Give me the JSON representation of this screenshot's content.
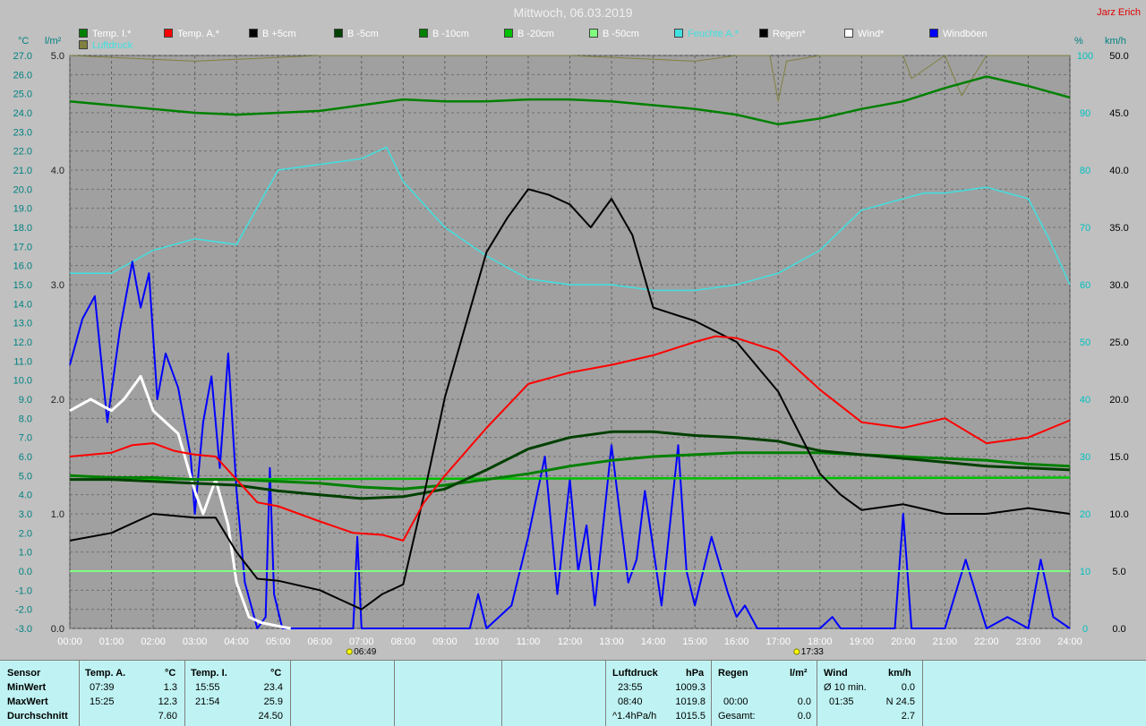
{
  "title": "Mittwoch, 06.03.2019",
  "author": "Jarz Erich",
  "units": {
    "left_temp": "°C",
    "left_rain": "l/m²",
    "right_pct": "%",
    "right_wind": "km/h"
  },
  "legend": [
    {
      "label": "Temp. I.*",
      "color": "#008000"
    },
    {
      "label": "Temp. A.*",
      "color": "#ff0000"
    },
    {
      "label": "B +5cm",
      "color": "#000000"
    },
    {
      "label": "B -5cm",
      "color": "#004000"
    },
    {
      "label": "B -10cm",
      "color": "#008000"
    },
    {
      "label": "B -20cm",
      "color": "#00c000"
    },
    {
      "label": "B -50cm",
      "color": "#80ff80"
    },
    {
      "label": "Feuchte A.*",
      "color": "#40e0e0"
    },
    {
      "label": "Regen*",
      "color": "#000000"
    },
    {
      "label": "Wind*",
      "color": "#ffffff"
    },
    {
      "label": "Windböen",
      "color": "#0000ff"
    },
    {
      "label": "Luftdruck",
      "color": "#808040"
    }
  ],
  "sunrise": "06:49",
  "sunset": "17:33",
  "chart_data": {
    "type": "line",
    "x_unit": "hours",
    "xlim": [
      0,
      24
    ],
    "x_ticks": [
      "00:00",
      "01:00",
      "02:00",
      "03:00",
      "04:00",
      "05:00",
      "06:00",
      "07:00",
      "08:00",
      "09:00",
      "10:00",
      "11:00",
      "12:00",
      "13:00",
      "14:00",
      "15:00",
      "16:00",
      "17:00",
      "18:00",
      "19:00",
      "20:00",
      "21:00",
      "22:00",
      "23:00",
      "24:00"
    ],
    "y_temp": {
      "lim": [
        -3,
        27
      ],
      "ticks": [
        "-3.0",
        "-2.0",
        "-1.0",
        "0.0",
        "1.0",
        "2.0",
        "3.0",
        "4.0",
        "5.0",
        "6.0",
        "7.0",
        "8.0",
        "9.0",
        "10.0",
        "11.0",
        "12.0",
        "13.0",
        "14.0",
        "15.0",
        "16.0",
        "17.0",
        "18.0",
        "19.0",
        "20.0",
        "21.0",
        "22.0",
        "23.0",
        "24.0",
        "25.0",
        "26.0",
        "27.0"
      ]
    },
    "y_rain": {
      "lim": [
        0,
        5
      ],
      "ticks": [
        "0.0",
        "1.0",
        "2.0",
        "3.0",
        "4.0",
        "5.0"
      ]
    },
    "y_pct": {
      "lim": [
        0,
        100
      ],
      "ticks": [
        "0",
        "10",
        "20",
        "30",
        "40",
        "50",
        "60",
        "70",
        "80",
        "90",
        "100"
      ]
    },
    "y_wind": {
      "lim": [
        0,
        50
      ],
      "ticks": [
        "0.0",
        "5.0",
        "10.0",
        "15.0",
        "20.0",
        "25.0",
        "30.0",
        "35.0",
        "40.0",
        "45.0",
        "50.0"
      ]
    },
    "series": [
      {
        "name": "Temp. I.*",
        "axis": "temp",
        "color": "#008000",
        "x": [
          0,
          1,
          2,
          3,
          4,
          5,
          6,
          7,
          8,
          9,
          10,
          11,
          12,
          13,
          14,
          15,
          16,
          17,
          18,
          19,
          20,
          21,
          22,
          23,
          24
        ],
        "y": [
          24.6,
          24.4,
          24.2,
          24.0,
          23.9,
          24.0,
          24.1,
          24.4,
          24.7,
          24.6,
          24.6,
          24.7,
          24.7,
          24.6,
          24.4,
          24.2,
          23.9,
          23.4,
          23.7,
          24.2,
          24.6,
          25.3,
          25.9,
          25.4,
          24.8
        ]
      },
      {
        "name": "Temp. A.*",
        "axis": "temp",
        "color": "#ff0000",
        "x": [
          0,
          1,
          1.5,
          2,
          2.5,
          3,
          3.5,
          4,
          4.5,
          5,
          6,
          6.8,
          7.5,
          8,
          8.5,
          9,
          10,
          11,
          12,
          13,
          14,
          15,
          15.5,
          16,
          17,
          18,
          19,
          20,
          21,
          22,
          23,
          24
        ],
        "y": [
          6.0,
          6.2,
          6.6,
          6.7,
          6.3,
          6.1,
          6.0,
          4.8,
          3.6,
          3.4,
          2.6,
          2.0,
          1.9,
          1.6,
          3.6,
          5.0,
          7.5,
          9.8,
          10.4,
          10.8,
          11.3,
          12.0,
          12.3,
          12.2,
          11.5,
          9.5,
          7.8,
          7.5,
          8.0,
          6.7,
          7.0,
          7.9
        ]
      },
      {
        "name": "B +5cm",
        "axis": "temp",
        "color": "#000000",
        "x": [
          0,
          1,
          2,
          3,
          3.5,
          4,
          4.5,
          5,
          6,
          7,
          7.5,
          8,
          8.5,
          9,
          10,
          10.5,
          11,
          11.5,
          12,
          12.5,
          13,
          13.5,
          14,
          15,
          16,
          17,
          18,
          18.5,
          19,
          20,
          21,
          22,
          23,
          24
        ],
        "y": [
          1.6,
          2.0,
          3.0,
          2.8,
          2.8,
          1.0,
          -0.4,
          -0.5,
          -1.0,
          -2.0,
          -1.2,
          -0.7,
          4.0,
          9.1,
          16.7,
          18.5,
          20.0,
          19.7,
          19.2,
          18.0,
          19.5,
          17.6,
          13.8,
          13.1,
          12.0,
          9.4,
          5.1,
          4.0,
          3.2,
          3.5,
          3.0,
          3.0,
          3.3,
          3.0
        ]
      },
      {
        "name": "B -5cm",
        "axis": "temp",
        "color": "#004000",
        "x": [
          0,
          1,
          2,
          3,
          4,
          5,
          6,
          7,
          8,
          9,
          10,
          11,
          12,
          13,
          14,
          15,
          16,
          17,
          18,
          19,
          20,
          21,
          22,
          23,
          24
        ],
        "y": [
          4.8,
          4.8,
          4.7,
          4.6,
          4.5,
          4.2,
          4.0,
          3.8,
          3.9,
          4.3,
          5.3,
          6.4,
          7.0,
          7.3,
          7.3,
          7.1,
          7.0,
          6.8,
          6.3,
          6.1,
          5.9,
          5.7,
          5.5,
          5.4,
          5.3
        ]
      },
      {
        "name": "B -10cm",
        "axis": "temp",
        "color": "#008000",
        "x": [
          0,
          1,
          2,
          3,
          4,
          5,
          6,
          7,
          8,
          9,
          10,
          11,
          12,
          13,
          14,
          15,
          16,
          17,
          18,
          19,
          20,
          21,
          22,
          23,
          24
        ],
        "y": [
          5.0,
          4.9,
          4.9,
          4.8,
          4.8,
          4.7,
          4.6,
          4.4,
          4.3,
          4.5,
          4.8,
          5.1,
          5.5,
          5.8,
          6.0,
          6.1,
          6.2,
          6.2,
          6.2,
          6.1,
          6.0,
          5.9,
          5.8,
          5.6,
          5.5
        ]
      },
      {
        "name": "B -20cm",
        "axis": "temp",
        "color": "#00c000",
        "x": [
          0,
          24
        ],
        "y": [
          4.8,
          4.9
        ]
      },
      {
        "name": "B -50cm",
        "axis": "temp",
        "color": "#80ff80",
        "x": [
          0,
          24
        ],
        "y": [
          0.0,
          0.0
        ]
      },
      {
        "name": "Feuchte A.*",
        "axis": "pct",
        "color": "#40e0e0",
        "x": [
          0,
          1,
          2,
          3,
          4,
          5,
          6,
          7,
          7.6,
          8,
          9,
          10,
          11,
          12,
          13,
          14,
          15,
          16,
          17,
          18,
          19,
          20,
          20.5,
          21,
          22,
          23,
          23.5,
          24
        ],
        "y": [
          62,
          62,
          66,
          68,
          67,
          80,
          81,
          82,
          84,
          78,
          70,
          65,
          61,
          60,
          60,
          59,
          59,
          60,
          62,
          66,
          73,
          75,
          76,
          76,
          77,
          75,
          68,
          60
        ]
      },
      {
        "name": "Wind*",
        "axis": "wind",
        "color": "#ffffff",
        "x": [
          0,
          0.5,
          1,
          1.3,
          1.7,
          2,
          2.3,
          2.6,
          3,
          3.2,
          3.5,
          3.8,
          4,
          4.3,
          4.6,
          5,
          5.3
        ],
        "y": [
          19,
          20,
          19,
          20,
          22,
          19,
          18,
          17,
          12,
          10,
          13,
          9,
          4,
          1,
          0.5,
          0.2,
          0
        ]
      },
      {
        "name": "Windböen",
        "axis": "wind",
        "color": "#0000ff",
        "x": [
          0,
          0.3,
          0.6,
          0.9,
          1.2,
          1.5,
          1.7,
          1.9,
          2.1,
          2.3,
          2.6,
          2.9,
          3.0,
          3.2,
          3.4,
          3.6,
          3.8,
          4.0,
          4.2,
          4.5,
          4.7,
          4.8,
          4.9,
          5.1,
          6.8,
          6.9,
          7.0,
          9.6,
          9.8,
          10.0,
          10.6,
          11.0,
          11.4,
          11.7,
          12.0,
          12.2,
          12.4,
          12.6,
          13.0,
          13.4,
          13.6,
          13.8,
          14.2,
          14.6,
          14.8,
          15.0,
          15.4,
          15.8,
          16.0,
          16.2,
          16.5,
          17.0,
          18.0,
          18.3,
          18.5,
          19.8,
          20.0,
          20.2,
          21.0,
          21.5,
          22.0,
          22.5,
          23.0,
          23.3,
          23.6,
          24.0
        ],
        "y": [
          23,
          27,
          29,
          18,
          26,
          32,
          28,
          31,
          20,
          24,
          21,
          15,
          10,
          18,
          22,
          14,
          24,
          12,
          4,
          0,
          1,
          14,
          3,
          0,
          0,
          8,
          0,
          0,
          3,
          0,
          2,
          8,
          15,
          3,
          13,
          5,
          9,
          2,
          16,
          4,
          6,
          12,
          2,
          16,
          5,
          2,
          8,
          3,
          1,
          2,
          0,
          0,
          0,
          1,
          0,
          0,
          10,
          0,
          0,
          6,
          0,
          1,
          0,
          6,
          1,
          0
        ]
      },
      {
        "name": "Luftdruck",
        "axis": "pct",
        "color": "#808040",
        "x": [
          0,
          3,
          6,
          9,
          12,
          15,
          16,
          16.8,
          17,
          17.2,
          18,
          19,
          20,
          20.2,
          21,
          21.4,
          22,
          24
        ],
        "y": [
          100,
          99,
          100,
          100,
          100,
          99,
          100,
          100,
          92,
          99,
          100,
          100,
          100,
          96,
          100,
          93,
          100,
          100
        ]
      }
    ]
  },
  "stats": {
    "sensor_header": "Sensor",
    "rows": [
      "MinWert",
      "MaxWert",
      "Durchschnitt"
    ],
    "temp_a": {
      "header": "Temp. A.",
      "unit": "°C",
      "min_time": "07:39",
      "min_value": "1.3",
      "max_time": "15:25",
      "max_value": "12.3",
      "avg": "7.60"
    },
    "temp_i": {
      "header": "Temp. I.",
      "unit": "°C",
      "min_time": "15:55",
      "min_value": "23.4",
      "max_time": "21:54",
      "max_value": "25.9",
      "avg": "24.50"
    },
    "luftdruck": {
      "header": "Luftdruck",
      "unit": "hPa",
      "min_time": "23:55",
      "min_value": "1009.3",
      "max_time": "08:40",
      "max_value": "1019.8",
      "trend_label": "^1.4hPa/h",
      "avg": "1015.5"
    },
    "regen": {
      "header": "Regen",
      "unit": "l/m²",
      "max_time": "00:00",
      "max_value": "0.0",
      "total_label": "Gesamt:",
      "total": "0.0"
    },
    "wind": {
      "header": "Wind",
      "unit": "km/h",
      "min_label": "Ø 10 min.",
      "min_value": "0.0",
      "max_time": "01:35",
      "max_value": "N 24.5",
      "avg": "2.7"
    }
  }
}
